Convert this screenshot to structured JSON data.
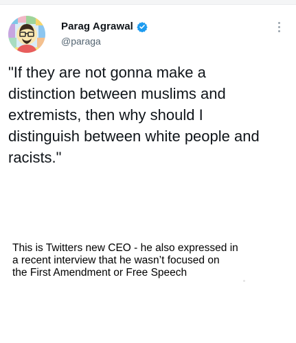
{
  "tweet": {
    "author": {
      "display_name": "Parag Agrawal",
      "handle": "@paraga",
      "verified_icon": "verified-badge-icon",
      "avatar_icon": "avatar-illustration"
    },
    "menu_icon": "more-vertical-icon",
    "text": "\"If they are not gonna make a\ndistinction between muslims and\nextremists, then why should I\ndistinguish between white people and\nracists.\""
  },
  "caption": {
    "text": "This is Twitters new CEO - he also expressed in\na recent interview that he wasn’t focused on\nthe First Amendment or Free Speech"
  },
  "colors": {
    "verified_blue": "#1d9bf0",
    "handle_gray": "#536471",
    "text_dark": "#0f1419"
  }
}
